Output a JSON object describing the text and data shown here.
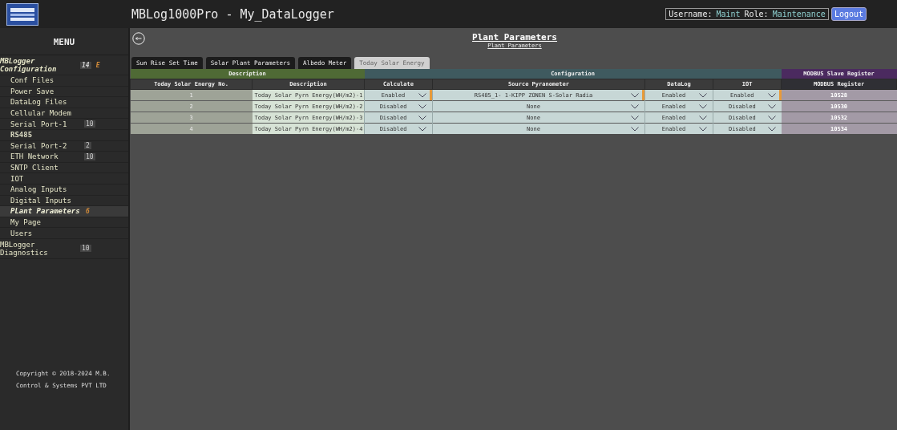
{
  "header": {
    "title": "MBLog1000Pro - My_DataLogger",
    "username_label": "Username:",
    "username": "Maint",
    "role_label": "Role:",
    "role": "Maintenance",
    "logout": "Logout"
  },
  "sidebar": {
    "menu_title": "MENU",
    "items": [
      {
        "label": "MBLogger Configuration",
        "kind": "heading",
        "badge": "14",
        "flag": "E",
        "selected": false
      },
      {
        "label": "Conf Files",
        "kind": "item",
        "selected": false
      },
      {
        "label": "Power Save",
        "kind": "item",
        "selected": false
      },
      {
        "label": "DataLog Files",
        "kind": "item",
        "selected": false
      },
      {
        "label": "Cellular Modem",
        "kind": "item",
        "selected": false
      },
      {
        "label": "Serial Port-1",
        "kind": "item",
        "badge": "10",
        "selected": false
      },
      {
        "label": "RS485",
        "kind": "subhead",
        "selected": false
      },
      {
        "label": "Serial Port-2",
        "kind": "item",
        "badge": "2",
        "selected": false
      },
      {
        "label": "ETH Network",
        "kind": "item",
        "badge": "10",
        "selected": false
      },
      {
        "label": "SNTP Client",
        "kind": "item",
        "selected": false
      },
      {
        "label": "IOT",
        "kind": "item",
        "selected": false
      },
      {
        "label": "Analog Inputs",
        "kind": "item",
        "selected": false
      },
      {
        "label": "Digital Inputs",
        "kind": "item",
        "selected": false
      },
      {
        "label": "PLant Parameters",
        "kind": "item",
        "flag": "6",
        "selected": true
      },
      {
        "label": "My Page",
        "kind": "item",
        "selected": false
      },
      {
        "label": "Users",
        "kind": "item",
        "selected": false
      },
      {
        "label": "MBLogger Diagnostics",
        "kind": "top",
        "badge": "10",
        "selected": false
      }
    ],
    "copyright": "Copyright © 2018-2024 M.B. Control & Systems PVT LTD"
  },
  "page_title": "Plant Parameters",
  "breadcrumb": "Plant Parameters",
  "tabs": [
    {
      "label": "Sun Rise Set Time",
      "selected": false
    },
    {
      "label": "Solar Plant Parameters",
      "selected": false
    },
    {
      "label": "Albedo Meter",
      "selected": false
    },
    {
      "label": "Today Solar Energy",
      "selected": true
    }
  ],
  "table": {
    "groups": [
      {
        "label": "Description",
        "color": "#4f6a35"
      },
      {
        "label": "Configuration",
        "color": "#3f5a5f"
      },
      {
        "label": "MODBUS Slave Register",
        "color": "#4b2a5f"
      }
    ],
    "columns": [
      "Today Solar Energy No.",
      "Description",
      "Calculate",
      "Source Pyranometer",
      "DataLog",
      "IOT",
      "MODBUS Register"
    ],
    "rows": [
      {
        "no": "1",
        "description": "Today Solar Pyrn Energy(WH/m2)-1",
        "calculate": {
          "value": "Enabled",
          "flagged": true
        },
        "source": {
          "value": "RS485_1- 1-KIPP ZONEN S-Solar Radia",
          "flagged": true
        },
        "datalog": {
          "value": "Enabled",
          "flagged": false
        },
        "iot": {
          "value": "Enabled",
          "flagged": true
        },
        "modbus": "10528"
      },
      {
        "no": "2",
        "description": "Today Solar Pyrn Energy(WH/m2)-2",
        "calculate": {
          "value": "Disabled",
          "flagged": false
        },
        "source": {
          "value": "None",
          "flagged": false
        },
        "datalog": {
          "value": "Enabled",
          "flagged": false
        },
        "iot": {
          "value": "Disabled",
          "flagged": false
        },
        "modbus": "10530"
      },
      {
        "no": "3",
        "description": "Today Solar Pyrn Energy(WH/m2)-3",
        "calculate": {
          "value": "Disabled",
          "flagged": false
        },
        "source": {
          "value": "None",
          "flagged": false
        },
        "datalog": {
          "value": "Enabled",
          "flagged": false
        },
        "iot": {
          "value": "Disabled",
          "flagged": false
        },
        "modbus": "10532"
      },
      {
        "no": "4",
        "description": "Today Solar Pyrn Energy(WH/m2)-4",
        "calculate": {
          "value": "Disabled",
          "flagged": false
        },
        "source": {
          "value": "None",
          "flagged": false
        },
        "datalog": {
          "value": "Enabled",
          "flagged": false
        },
        "iot": {
          "value": "Disabled",
          "flagged": false
        },
        "modbus": "10534"
      }
    ]
  }
}
